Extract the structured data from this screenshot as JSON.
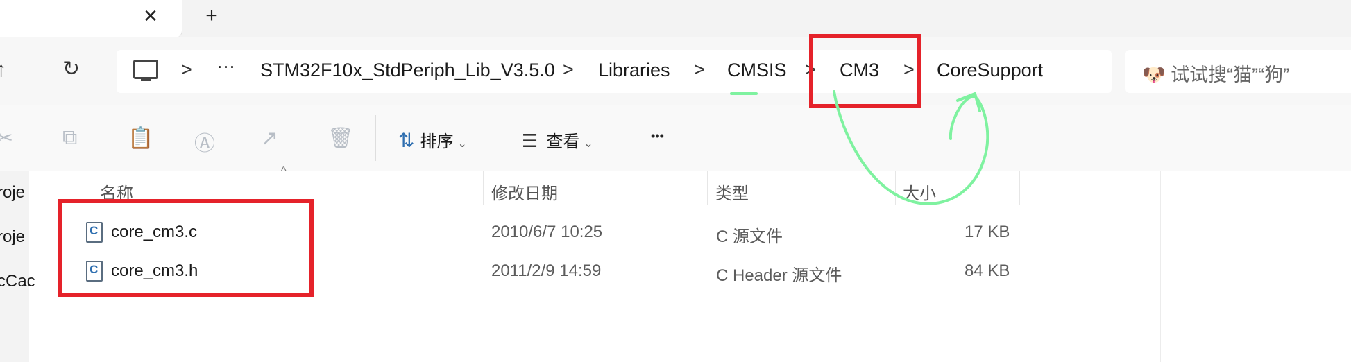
{
  "tabs": {
    "close_icon": "close-icon",
    "close_glyph": "✕",
    "new_tab_icon": "plus-icon",
    "new_tab_glyph": "+"
  },
  "nav": {
    "up_glyph": "↑",
    "refresh_glyph": "↻"
  },
  "breadcrumb": {
    "separator": ">",
    "ellipsis": "···",
    "items": [
      "STM32F10x_StdPeriph_Lib_V3.5.0",
      "Libraries",
      "CMSIS",
      "CM3",
      "CoreSupport"
    ]
  },
  "search": {
    "emoji": "🐶",
    "placeholder": "试试搜“猫”“狗”"
  },
  "toolbar": {
    "cut_glyph": "✂",
    "copy_glyph": "⧉",
    "paste_glyph": "📋",
    "rename_glyph": "Ⓐ",
    "share_glyph": "↗",
    "delete_glyph": "🗑",
    "sort_icon_glyph": "⇅",
    "sort_label": "排序",
    "view_icon_glyph": "☰",
    "view_label": "查看",
    "more_glyph": "•••",
    "chevron": "⌄"
  },
  "nav_pane": {
    "items": [
      "roje",
      "roje",
      "cCac"
    ]
  },
  "columns": {
    "name": "名称",
    "modified": "修改日期",
    "type": "类型",
    "size": "大小",
    "sort_caret": "^"
  },
  "files": [
    {
      "icon_letter": "C",
      "name": "core_cm3.c",
      "modified": "2010/6/7 10:25",
      "type": "C 源文件",
      "size": "17 KB"
    },
    {
      "icon_letter": "C",
      "name": "core_cm3.h",
      "modified": "2011/2/9 14:59",
      "type": "C Header 源文件",
      "size": "84 KB"
    }
  ],
  "annotation_colors": {
    "red_box": "#e5222a",
    "green_stroke": "#7ff2a0"
  }
}
